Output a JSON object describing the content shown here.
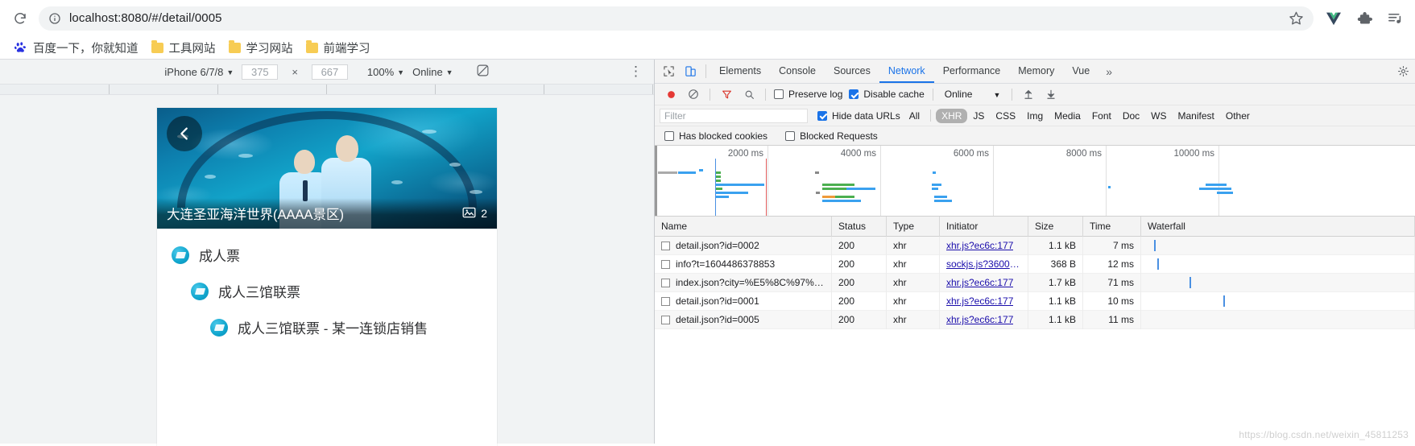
{
  "browser": {
    "reload_icon": "reload-icon",
    "info_icon": "page-info-icon",
    "url": "localhost:8080/#/detail/0005",
    "star_icon": "bookmark-star-icon",
    "extension_icons": [
      "vue-devtools-icon",
      "extensions-puzzle-icon",
      "reading-list-icon"
    ],
    "bookmarks": [
      {
        "label": "百度一下，你就知道",
        "icon": "baidu-icon"
      },
      {
        "label": "工具网站",
        "icon": "folder-icon"
      },
      {
        "label": "学习网站",
        "icon": "folder-icon"
      },
      {
        "label": "前端学习",
        "icon": "folder-icon"
      }
    ]
  },
  "device_toolbar": {
    "device": "iPhone 6/7/8",
    "width": "375",
    "height": "667",
    "multiply": "×",
    "zoom": "100%",
    "network": "Online",
    "rotate_icon": "rotate-device-icon",
    "menu_icon": "more-vertical-icon"
  },
  "preview": {
    "back_icon": "back-chevron-icon",
    "hero_title": "大连圣亚海洋世界(AAAA景区)",
    "photo_icon": "photo-icon",
    "photo_count": "2",
    "tickets": [
      {
        "label": "成人票",
        "level": 1,
        "icon": "ticket-icon"
      },
      {
        "label": "成人三馆联票",
        "level": 2,
        "icon": "ticket-icon"
      },
      {
        "label": "成人三馆联票 - 某一连锁店销售",
        "level": 3,
        "icon": "ticket-icon"
      }
    ]
  },
  "devtools": {
    "inspect_icon": "inspect-element-icon",
    "device_toggle_icon": "toggle-device-toolbar-icon",
    "tabs": [
      {
        "label": "Elements",
        "active": false
      },
      {
        "label": "Console",
        "active": false
      },
      {
        "label": "Sources",
        "active": false
      },
      {
        "label": "Network",
        "active": true
      },
      {
        "label": "Performance",
        "active": false
      },
      {
        "label": "Memory",
        "active": false
      },
      {
        "label": "Vue",
        "active": false
      }
    ],
    "more_tabs_icon": "chevron-double-right-icon",
    "settings_icon": "gear-icon",
    "network_toolbar": {
      "record_icon": "record-circle-icon",
      "clear_icon": "clear-no-entry-icon",
      "filter_icon": "filter-funnel-icon",
      "search_icon": "search-icon",
      "preserve_log": {
        "label": "Preserve log",
        "checked": false
      },
      "disable_cache": {
        "label": "Disable cache",
        "checked": true
      },
      "throttle": "Online",
      "import_icon": "import-arrow-up-icon",
      "export_icon": "export-arrow-down-icon"
    },
    "filter_row": {
      "placeholder": "Filter",
      "hide_data_urls": {
        "label": "Hide data URLs",
        "checked": true
      },
      "types": [
        {
          "label": "All",
          "active": false
        },
        {
          "label": "XHR",
          "active": true
        },
        {
          "label": "JS",
          "active": false
        },
        {
          "label": "CSS",
          "active": false
        },
        {
          "label": "Img",
          "active": false
        },
        {
          "label": "Media",
          "active": false
        },
        {
          "label": "Font",
          "active": false
        },
        {
          "label": "Doc",
          "active": false
        },
        {
          "label": "WS",
          "active": false
        },
        {
          "label": "Manifest",
          "active": false
        },
        {
          "label": "Other",
          "active": false
        }
      ]
    },
    "blocked_row": {
      "has_blocked_cookies": {
        "label": "Has blocked cookies",
        "checked": false
      },
      "blocked_requests": {
        "label": "Blocked Requests",
        "checked": false
      }
    },
    "overview": {
      "ticks": [
        "2000 ms",
        "4000 ms",
        "6000 ms",
        "8000 ms",
        "10000 ms"
      ]
    },
    "table": {
      "columns": [
        "Name",
        "Status",
        "Type",
        "Initiator",
        "Size",
        "Time",
        "Waterfall"
      ],
      "rows": [
        {
          "name": "detail.json?id=0002",
          "status": "200",
          "type": "xhr",
          "initiator": "xhr.js?ec6c:177",
          "size": "1.1 kB",
          "time": "7 ms"
        },
        {
          "name": "info?t=1604486378853",
          "status": "200",
          "type": "xhr",
          "initiator": "sockjs.js?3600:…",
          "size": "368 B",
          "time": "12 ms"
        },
        {
          "name": "index.json?city=%E5%8C%97%…",
          "status": "200",
          "type": "xhr",
          "initiator": "xhr.js?ec6c:177",
          "size": "1.7 kB",
          "time": "71 ms"
        },
        {
          "name": "detail.json?id=0001",
          "status": "200",
          "type": "xhr",
          "initiator": "xhr.js?ec6c:177",
          "size": "1.1 kB",
          "time": "10 ms"
        },
        {
          "name": "detail.json?id=0005",
          "status": "200",
          "type": "xhr",
          "initiator": "xhr.js?ec6c:177",
          "size": "1.1 kB",
          "time": "11 ms"
        }
      ]
    },
    "watermark": "https://blog.csdn.net/weixin_45811253"
  },
  "colors": {
    "accent": "#1a73e8",
    "link": "#1a0dab",
    "record": "#e53935",
    "filter_active": "#d93025",
    "waterfall_blue": "#4a90e2",
    "waterfall_red": "#e05a5a"
  }
}
